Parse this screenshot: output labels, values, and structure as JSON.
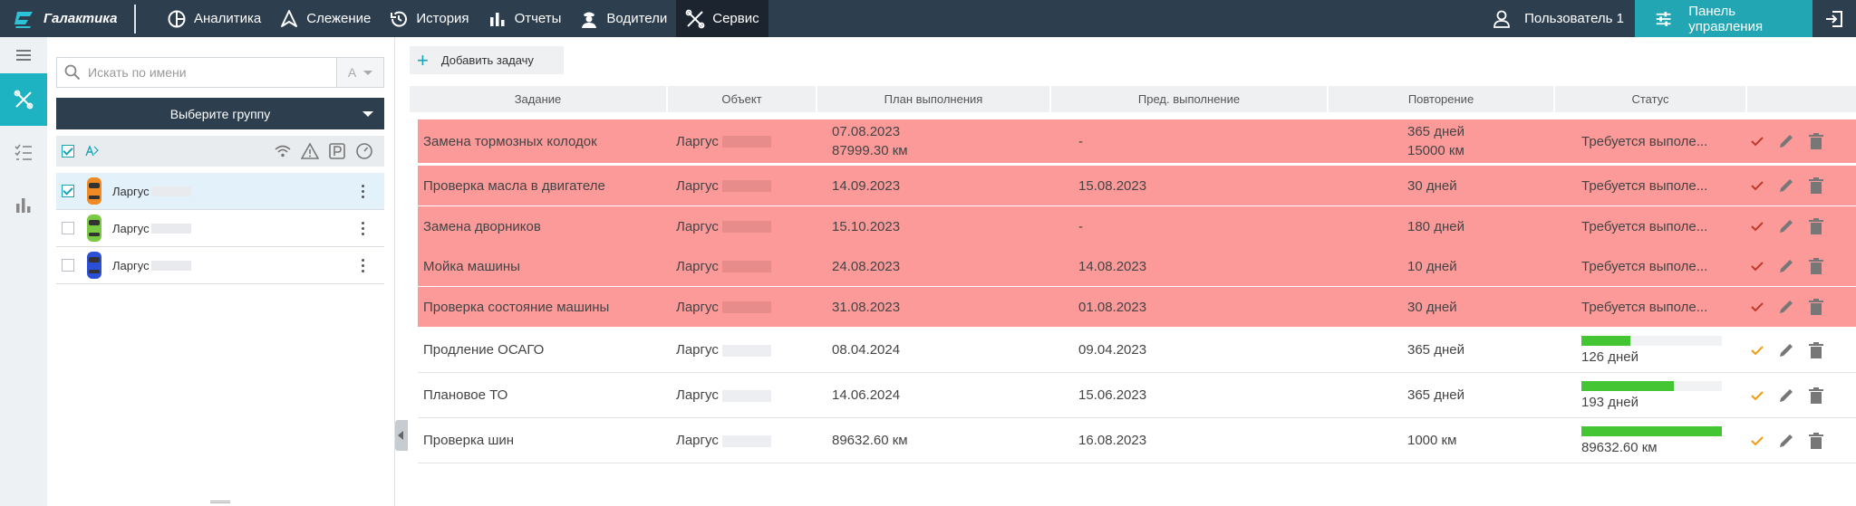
{
  "topbar": {
    "brand": "Галактика",
    "nav": [
      {
        "label": "Аналитика",
        "icon": "analytics-icon"
      },
      {
        "label": "Слежение",
        "icon": "tracking-icon"
      },
      {
        "label": "История",
        "icon": "history-icon"
      },
      {
        "label": "Отчеты",
        "icon": "reports-icon"
      },
      {
        "label": "Водители",
        "icon": "drivers-icon"
      },
      {
        "label": "Сервис",
        "icon": "service-icon",
        "active": true
      }
    ],
    "user": "Пользователь 1",
    "panel": "Панель управления"
  },
  "sidebar": {
    "search_placeholder": "Искать по имени",
    "sort_label": "A",
    "group_button": "Выберите группу",
    "vehicles": [
      {
        "name": "Ларгус",
        "color": "#f08a24",
        "selected": true
      },
      {
        "name": "Ларгус",
        "color": "#7ac943",
        "selected": false
      },
      {
        "name": "Ларгус",
        "color": "#2c4fd8",
        "selected": false
      }
    ]
  },
  "main": {
    "add_button": "Добавить задачу",
    "columns": [
      "Задание",
      "Объект",
      "План выполнения",
      "Пред. выполнение",
      "Повторение",
      "Статус"
    ],
    "rows": [
      {
        "task": "Замена тормозных колодок",
        "object": "Ларгус",
        "plan1": "07.08.2023",
        "plan2": "87999.30 км",
        "prev": "-",
        "rep1": "365 дней",
        "rep2": "15000 км",
        "status": "Требуется выполе...",
        "state": "alert"
      },
      {
        "task": "Проверка масла в двигателе",
        "object": "Ларгус",
        "plan1": "14.09.2023",
        "plan2": "",
        "prev": "15.08.2023",
        "rep1": "30 дней",
        "rep2": "",
        "status": "Требуется выполе...",
        "state": "alert"
      },
      {
        "task": "Замена дворников",
        "object": "Ларгус",
        "plan1": "15.10.2023",
        "plan2": "",
        "prev": "-",
        "rep1": "180 дней",
        "rep2": "",
        "status": "Требуется выполе...",
        "state": "alert"
      },
      {
        "task": "Мойка машины",
        "object": "Ларгус",
        "plan1": "24.08.2023",
        "plan2": "",
        "prev": "14.08.2023",
        "rep1": "10 дней",
        "rep2": "",
        "status": "Требуется выполе...",
        "state": "alert"
      },
      {
        "task": "Проверка состояние машины",
        "object": "Ларгус",
        "plan1": "31.08.2023",
        "plan2": "",
        "prev": "01.08.2023",
        "rep1": "30 дней",
        "rep2": "",
        "status": "Требуется выполе...",
        "state": "alert"
      },
      {
        "task": "Продление ОСАГО",
        "object": "Ларгус",
        "plan1": "08.04.2024",
        "plan2": "",
        "prev": "09.04.2023",
        "rep1": "365 дней",
        "rep2": "",
        "status": "126 дней",
        "progress": 0.35,
        "state": "ok"
      },
      {
        "task": "Плановое ТО",
        "object": "Ларгус",
        "plan1": "14.06.2024",
        "plan2": "",
        "prev": "15.06.2023",
        "rep1": "365 дней",
        "rep2": "",
        "status": "193 дней",
        "progress": 0.66,
        "state": "ok"
      },
      {
        "task": "Проверка шин",
        "object": "Ларгус",
        "plan1": "89632.60 км",
        "plan2": "",
        "prev": "16.08.2023",
        "rep1": "1000 км",
        "rep2": "",
        "status": "89632.60 км",
        "progress": 1.0,
        "state": "ok"
      }
    ]
  },
  "colors": {
    "topbar": "#2d3e4f",
    "accent": "#1db3c2",
    "alert_row": "#fc9a9a",
    "progress": "#44c533",
    "check_ok": "#f39c12",
    "check_alert": "#c0392b"
  }
}
